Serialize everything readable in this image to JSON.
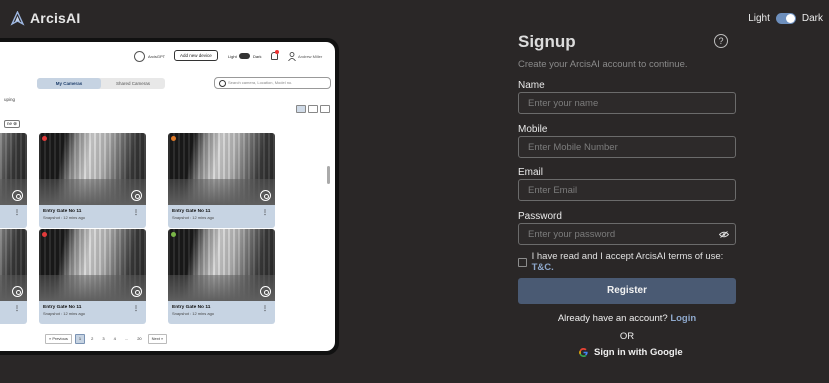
{
  "app": {
    "name": "ArcisAI"
  },
  "theme_toggle": {
    "light_label": "Light",
    "dark_label": "Dark",
    "selected": "Dark"
  },
  "preview": {
    "org_name": "ArcisGPT",
    "add_device_label": "Add new device",
    "light_label": "Light",
    "dark_label": "Dark",
    "user_name": "Andrew Miller",
    "tabs": [
      {
        "label": "My Cameras",
        "active": true
      },
      {
        "label": "Shared Cameras",
        "active": false
      }
    ],
    "search_placeholder": "Search camera, Location, Model no.",
    "grouping_label": "uping",
    "filter_label": "ne",
    "cameras": [
      {
        "title": "Entry Gate No 11",
        "subtitle": "Snapshot : 12 mins ago",
        "status_color": "#e23b3b"
      },
      {
        "title": "Entry Gate No 11",
        "subtitle": "Snapshot : 12 mins ago",
        "status_color": "#e07a28"
      },
      {
        "title": "Entry Gate No 11",
        "subtitle": "Snapshot : 12 mins ago",
        "status_color": "#e23b3b"
      },
      {
        "title": "Entry Gate No 11",
        "subtitle": "Snapshot : 12 mins ago",
        "status_color": "#7ab648"
      }
    ],
    "pagination": {
      "previous": "« Previous",
      "pages": [
        "1",
        "2",
        "3",
        "4",
        "...",
        "20"
      ],
      "current": "1",
      "next": "Next »"
    }
  },
  "signup": {
    "title": "Signup",
    "help_icon": "?",
    "subtitle": "Create your ArcisAI account to continue.",
    "fields": {
      "name": {
        "label": "Name",
        "placeholder": "Enter your name"
      },
      "mobile": {
        "label": "Mobile",
        "placeholder": "Enter Mobile Number"
      },
      "email": {
        "label": "Email",
        "placeholder": "Enter Email"
      },
      "password": {
        "label": "Password",
        "placeholder": "Enter your password"
      }
    },
    "terms_text": "I have read and I accept ArcisAI terms of use: ",
    "terms_link": "T&C.",
    "register_label": "Register",
    "have_account_text": "Already have an account? ",
    "login_link": "Login",
    "or_text": "OR",
    "google_label": "Sign in with Google"
  },
  "colors": {
    "background": "#2a2727",
    "accent": "#8ea8cc",
    "register_button": "#4a5a73"
  }
}
